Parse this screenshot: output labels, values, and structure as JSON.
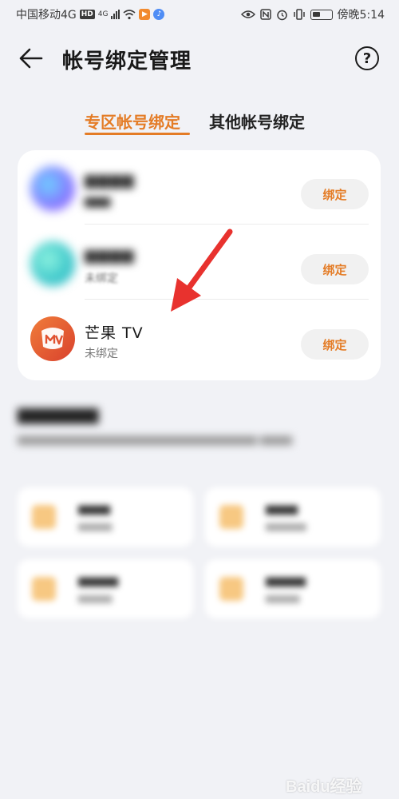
{
  "status_bar": {
    "carrier": "中国移动4G",
    "hd": "HD",
    "small_4g": "4G",
    "time": "傍晚5:14",
    "icons": [
      "signal-icon",
      "wifi-icon",
      "app-notification-icon",
      "music-notification-icon",
      "eye-icon",
      "nfc-icon",
      "alarm-icon",
      "vibrate-icon",
      "battery-icon"
    ]
  },
  "header": {
    "title": "帐号绑定管理",
    "help_label": "?"
  },
  "tabs": [
    {
      "label": "专区帐号绑定",
      "active": true
    },
    {
      "label": "其他帐号绑定",
      "active": false
    }
  ],
  "accounts": [
    {
      "name": "",
      "status": "",
      "button": "绑定",
      "icon": "video-app-icon",
      "blurred": true
    },
    {
      "name": "",
      "status": "未绑定",
      "button": "绑定",
      "icon": "music-app-icon",
      "blurred": true
    },
    {
      "name": "芒果 TV",
      "status": "未绑定",
      "button": "绑定",
      "icon": "mango-tv-icon",
      "blurred": false
    }
  ],
  "colors": {
    "accent": "#e47c26",
    "arrow": "#e8322e",
    "background": "#f1f2f6",
    "card": "#ffffff"
  },
  "watermark": "Baidu经验"
}
